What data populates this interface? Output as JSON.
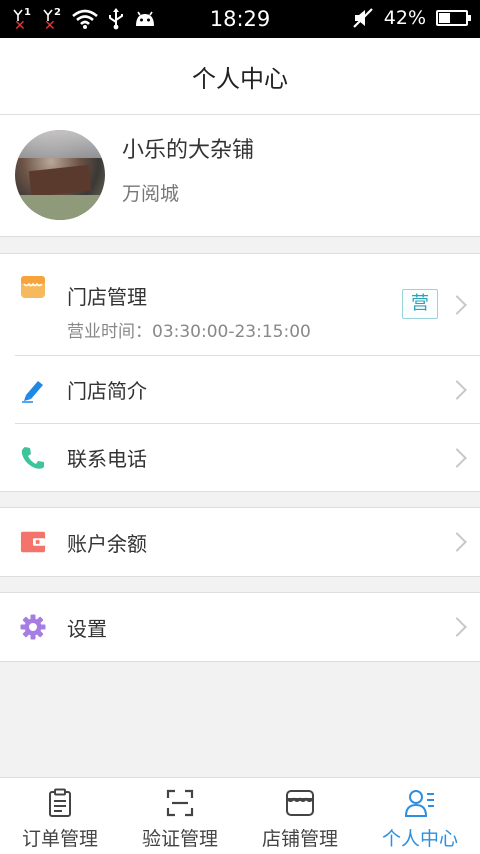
{
  "status_bar": {
    "sim1": "1",
    "sim2": "2",
    "time": "18:29",
    "battery_text": "42%",
    "battery_level": 0.42
  },
  "nav": {
    "title": "个人中心"
  },
  "profile": {
    "name": "小乐的大杂铺",
    "location": "万阅城"
  },
  "menu": {
    "store": {
      "label": "门店管理",
      "hours_text": "营业时间：03:30:00-23:15:00",
      "badge": "营",
      "icon": "store-icon",
      "color": "#f7b95d"
    },
    "intro": {
      "label": "门店简介",
      "icon": "pencil-icon",
      "color": "#1e88e5"
    },
    "phone": {
      "label": "联系电话",
      "icon": "phone-icon",
      "color": "#3cc49b"
    },
    "balance": {
      "label": "账户余额",
      "icon": "wallet-icon",
      "color": "#f4736a"
    },
    "settings": {
      "label": "设置",
      "icon": "gear-icon",
      "color": "#a67de2"
    }
  },
  "tabs": [
    {
      "label": "订单管理",
      "icon": "clipboard-icon",
      "active": false
    },
    {
      "label": "验证管理",
      "icon": "scan-icon",
      "active": false
    },
    {
      "label": "店铺管理",
      "icon": "shop-icon",
      "active": false
    },
    {
      "label": "个人中心",
      "icon": "person-list-icon",
      "active": true
    }
  ],
  "colors": {
    "accent": "#2e8fe0",
    "background": "#f2f2f2"
  }
}
